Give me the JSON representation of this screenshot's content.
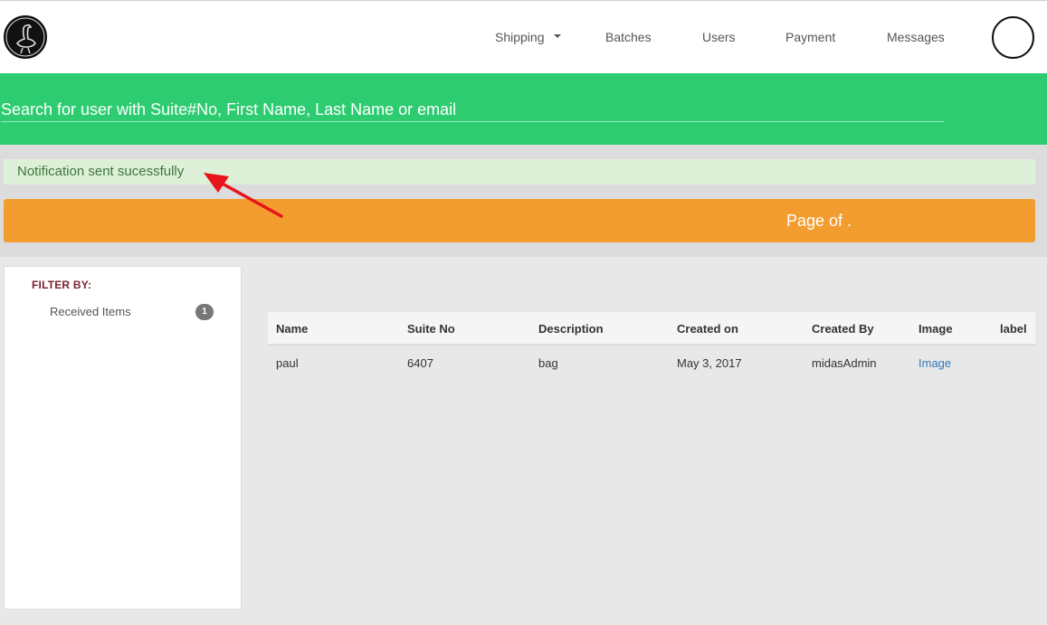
{
  "nav": {
    "items": [
      "Shipping",
      "Batches",
      "Users",
      "Payment",
      "Messages"
    ]
  },
  "search": {
    "placeholder": "Search for user with Suite#No, First Name, Last Name or email"
  },
  "alert": {
    "message": "Notification sent sucessfully"
  },
  "pager": {
    "text": "Page of ."
  },
  "sidebar": {
    "filter_title": "FILTER BY:",
    "items": [
      {
        "label": "Received Items",
        "count": "1"
      }
    ]
  },
  "table": {
    "headers": [
      "Name",
      "Suite No",
      "Description",
      "Created on",
      "Created By",
      "Image",
      "label"
    ],
    "rows": [
      {
        "name": "paul",
        "suite_no": "6407",
        "description": "bag",
        "created_on": "May 3, 2017",
        "created_by": "midasAdmin",
        "image": "Image",
        "label": ""
      }
    ]
  },
  "colors": {
    "search_band": "#2ecc71",
    "pager_bar": "#f39c2f",
    "alert_bg": "#dff0d8",
    "alert_text": "#3c763d",
    "filter_title": "#7a1f2e",
    "link": "#337ab7",
    "annotation_arrow": "#e8141b"
  },
  "icons": {
    "logo": "ostrich-logo-icon",
    "dropdown": "caret-down-icon",
    "avatar": "user-avatar-icon",
    "annotation": "red-arrow-annotation"
  }
}
